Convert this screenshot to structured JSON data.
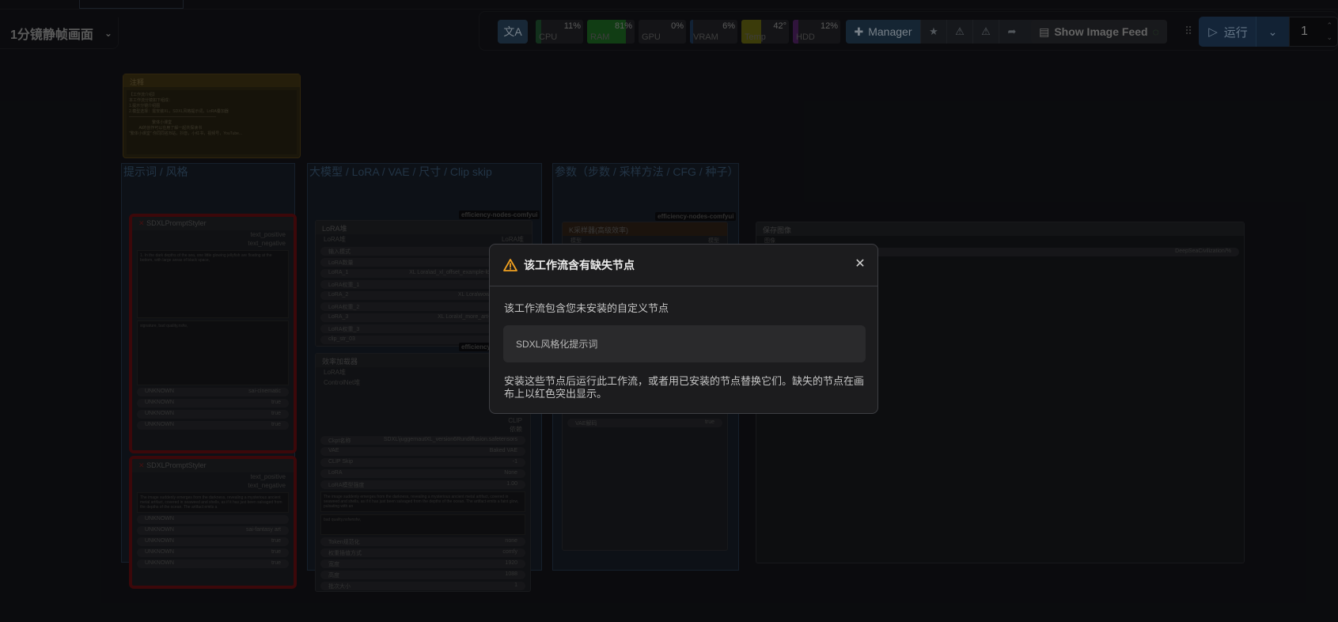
{
  "workflow": {
    "title": "1分镜静帧画面"
  },
  "topbar": {
    "translate_icon": "translate-icon",
    "monitors": [
      {
        "label": "CPU",
        "value": "11%",
        "percent": 11,
        "color": "#1d4a2b"
      },
      {
        "label": "RAM",
        "value": "81%",
        "percent": 81,
        "color": "#1b5e20"
      },
      {
        "label": "GPU",
        "value": "0%",
        "percent": 0,
        "color": "#1f3b23"
      },
      {
        "label": "VRAM",
        "value": "6%",
        "percent": 6,
        "color": "#1c3552"
      },
      {
        "label": "Temp",
        "value": "42°",
        "percent": 42,
        "color": "#5b5b10"
      },
      {
        "label": "HDD",
        "value": "12%",
        "percent": 12,
        "color": "#4a1f5c"
      }
    ],
    "manager_label": "Manager",
    "show_image_feed": "Show Image Feed",
    "run_label": "运行",
    "batch_count": "1"
  },
  "canvas": {
    "note_title": "注释",
    "note_text": "【工作流介绍】\n本工作流分镜如下组成：\n1.提示分镜介绍图\n2.模型选择：需安装XL，SDXL风格提示词，LoRA叠加器\n——————————————————————\n                     繁体小课堂\n         AI的创作可以在用了解一起共探读书\n\"繁体小课堂\" 你同同名'B站，抖音，小红书，视频号，YouTube...",
    "groups": [
      {
        "title": "提示词 / 风格"
      },
      {
        "title": "大模型 / LoRA /  VAE / 尺寸 / Clip skip"
      },
      {
        "title": "参数（步数 / 采样方法 / CFG / 种子）"
      }
    ],
    "styler1": {
      "title": "SDXLPromptStyler",
      "out1": "text_positive",
      "out2": "text_negative",
      "prompt": "1. In the dark depths of the sea, one little glowing jellyfish are floating at the bottom, with large areas of black space,",
      "negative": "signature, bad quality,nsfw,",
      "rows": [
        {
          "k": "UNKNOWN",
          "v": "sai-cinematic"
        },
        {
          "k": "UNKNOWN",
          "v": "true"
        },
        {
          "k": "UNKNOWN",
          "v": "true"
        },
        {
          "k": "UNKNOWN",
          "v": "true"
        }
      ]
    },
    "styler2": {
      "title": "SDXLPromptStyler",
      "out1": "text_positive",
      "out2": "text_negative",
      "prompt": "The image suddenly emerges from the darkness, revealing a mysterious ancient metal artifact, covered in seaweed and shells, as if it has just been salvaged from the depths of the ocean. The artifact emits a",
      "rows": [
        {
          "k": "UNKNOWN",
          "v": ""
        },
        {
          "k": "UNKNOWN",
          "v": "sai-fantasy art"
        },
        {
          "k": "UNKNOWN",
          "v": "true"
        },
        {
          "k": "UNKNOWN",
          "v": "true"
        },
        {
          "k": "UNKNOWN",
          "v": "true"
        }
      ]
    },
    "lora": {
      "badge": "efficiency-nodes-comfyui",
      "title": "LoRA堆",
      "in_label": "LoRA堆",
      "out_label": "LoRA堆",
      "rows": [
        {
          "k": "输入模式",
          "v": ""
        },
        {
          "k": "LoRA数量",
          "v": ""
        },
        {
          "k": "LoRA_1",
          "v": "XL Lora\\ad_xl_offset_example-lora_1.0.safet"
        },
        {
          "k": "LoRA权重_1",
          "v": ""
        },
        {
          "k": "LoRA_2",
          "v": "XL Lora\\wowifierXL.safet"
        },
        {
          "k": "LoRA权重_2",
          "v": ""
        },
        {
          "k": "LoRA_3",
          "v": "XL Lora\\xl_more_art-full_v1.safet"
        },
        {
          "k": "LoRA权重_3",
          "v": ""
        },
        {
          "k": "clip_str_03",
          "v": ""
        }
      ]
    },
    "loader": {
      "badge": "efficiency-n",
      "title": "效率加载器",
      "in1": "LoRA堆",
      "in2": "ControlNet堆",
      "out1": "CLIP",
      "out2": "依赖",
      "rows": [
        {
          "k": "Ckpt名称",
          "v": "SDXL\\juggernautXL_version6Rundiffusion.safetensors"
        },
        {
          "k": "VAE",
          "v": "Baked VAE"
        },
        {
          "k": "CLIP Skip",
          "v": "-1"
        },
        {
          "k": "LoRA",
          "v": "None"
        },
        {
          "k": "LoRA模型强度",
          "v": "1.00"
        }
      ],
      "pos_text": "The image suddenly emerges from the darkness, revealing a mysterious ancient metal artifact, covered in seaweed and shells, as if it has just been salvaged from the depths of the ocean. The artifact emits a faint glow, pulsating with an",
      "neg_text": "bad quality,nsfwnsfw,",
      "rows2": [
        {
          "k": "Token规范化",
          "v": "none"
        },
        {
          "k": "权重插值方式",
          "v": "comfy"
        },
        {
          "k": "宽度",
          "v": "1920"
        },
        {
          "k": "高度",
          "v": "1088"
        },
        {
          "k": "批次大小",
          "v": "1"
        }
      ]
    },
    "ksampler": {
      "badge": "efficiency-nodes-comfyui",
      "title": "K采样器(高级效率)",
      "in1": "模型",
      "out1": "模型",
      "vae_row": {
        "k": "VAE解码",
        "v": "true"
      }
    },
    "save": {
      "title": "保存图像",
      "in1": "图像",
      "prefix": "DeepSeaCivilization/%"
    }
  },
  "dialog": {
    "title": "该工作流含有缺失节点",
    "message": "该工作流包含您未安装的自定义节点",
    "missing_nodes": [
      "SDXL风格化提示词"
    ],
    "footer": "安装这些节点后运行此工作流，或者用已安装的节点替换它们。缺失的节点在画布上以红色突出显示。"
  }
}
